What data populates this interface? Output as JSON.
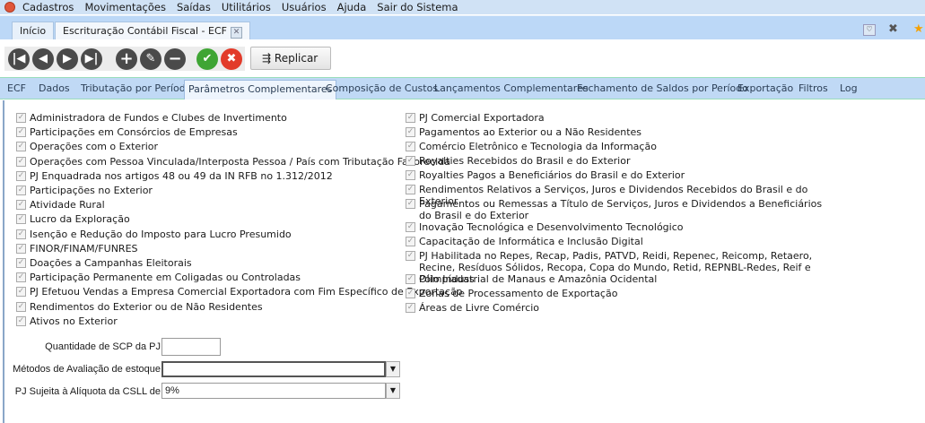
{
  "menu": {
    "items": [
      "Cadastros",
      "Movimentações",
      "Saídas",
      "Utilitários",
      "Usuários",
      "Ajuda",
      "Sair do Sistema"
    ]
  },
  "doc_tabs": {
    "home": "Início",
    "active": "Escrituração Contábil Fiscal - ECF"
  },
  "toolbar": {
    "replicate_label": "Replicar"
  },
  "sub_tabs": [
    "ECF",
    "Dados",
    "Tributação por Período",
    "Parâmetros Complementares",
    "Composição de Custos",
    "Lançamentos Complementares",
    "Fechamento de Saldos por Período",
    "Exportação",
    "Filtros",
    "Log"
  ],
  "active_sub_tab": "Parâmetros Complementares",
  "left_checks": [
    "Administradora de Fundos e Clubes de Invertimento",
    "Participações em Consórcios de Empresas",
    "Operações com o Exterior",
    "Operações com Pessoa Vinculada/Interposta Pessoa / País com Tributação Favorecida",
    "PJ Enquadrada nos artigos 48 ou 49 da IN RFB no 1.312/2012",
    "Participações no Exterior",
    "Atividade Rural",
    "Lucro da Exploração",
    "Isenção e Redução do Imposto para Lucro Presumido",
    "FINOR/FINAM/FUNRES",
    "Doações a Campanhas Eleitorais",
    "Participação Permanente em Coligadas ou Controladas",
    "PJ Efetuou Vendas a Empresa Comercial Exportadora com Fim Específico de Exportação",
    "Rendimentos do Exterior ou de Não Residentes",
    "Ativos no Exterior"
  ],
  "right_checks": [
    "PJ Comercial Exportadora",
    "Pagamentos ao Exterior ou a Não Residentes",
    "Comércio Eletrônico e Tecnologia da Informação",
    "Royalties Recebidos do Brasil e do Exterior",
    "Royalties Pagos a Beneficiários do Brasil e do Exterior",
    "Rendimentos Relativos a Serviços, Juros e Dividendos Recebidos do Brasil e do Exterior",
    "Pagamentos ou Remessas a Título de Serviços, Juros e Dividendos a Beneficiários do Brasil e do Exterior",
    "Inovação Tecnológica e Desenvolvimento Tecnológico",
    "Capacitação de Informática e Inclusão Digital",
    "PJ Habilitada no Repes, Recap, Padis, PATVD, Reidi, Repenec, Reicomp, Retaero, Recine, Resíduos Sólidos, Recopa, Copa do Mundo, Retid, REPNBL-Redes, Reif e Olimpíadas",
    "Pólo Industrial de Manaus e Amazônia Ocidental",
    "Zonas de Processamento de Exportação",
    "Áreas de Livre Comércio"
  ],
  "checked": true,
  "form": {
    "scp_label": "Quantidade de SCP da PJ",
    "scp_value": "",
    "estoque_label": "Métodos de Avaliação de estoque",
    "estoque_value": "",
    "csll_label": "PJ Sujeita à Alíquota da CSLL de",
    "csll_value": "9%"
  }
}
